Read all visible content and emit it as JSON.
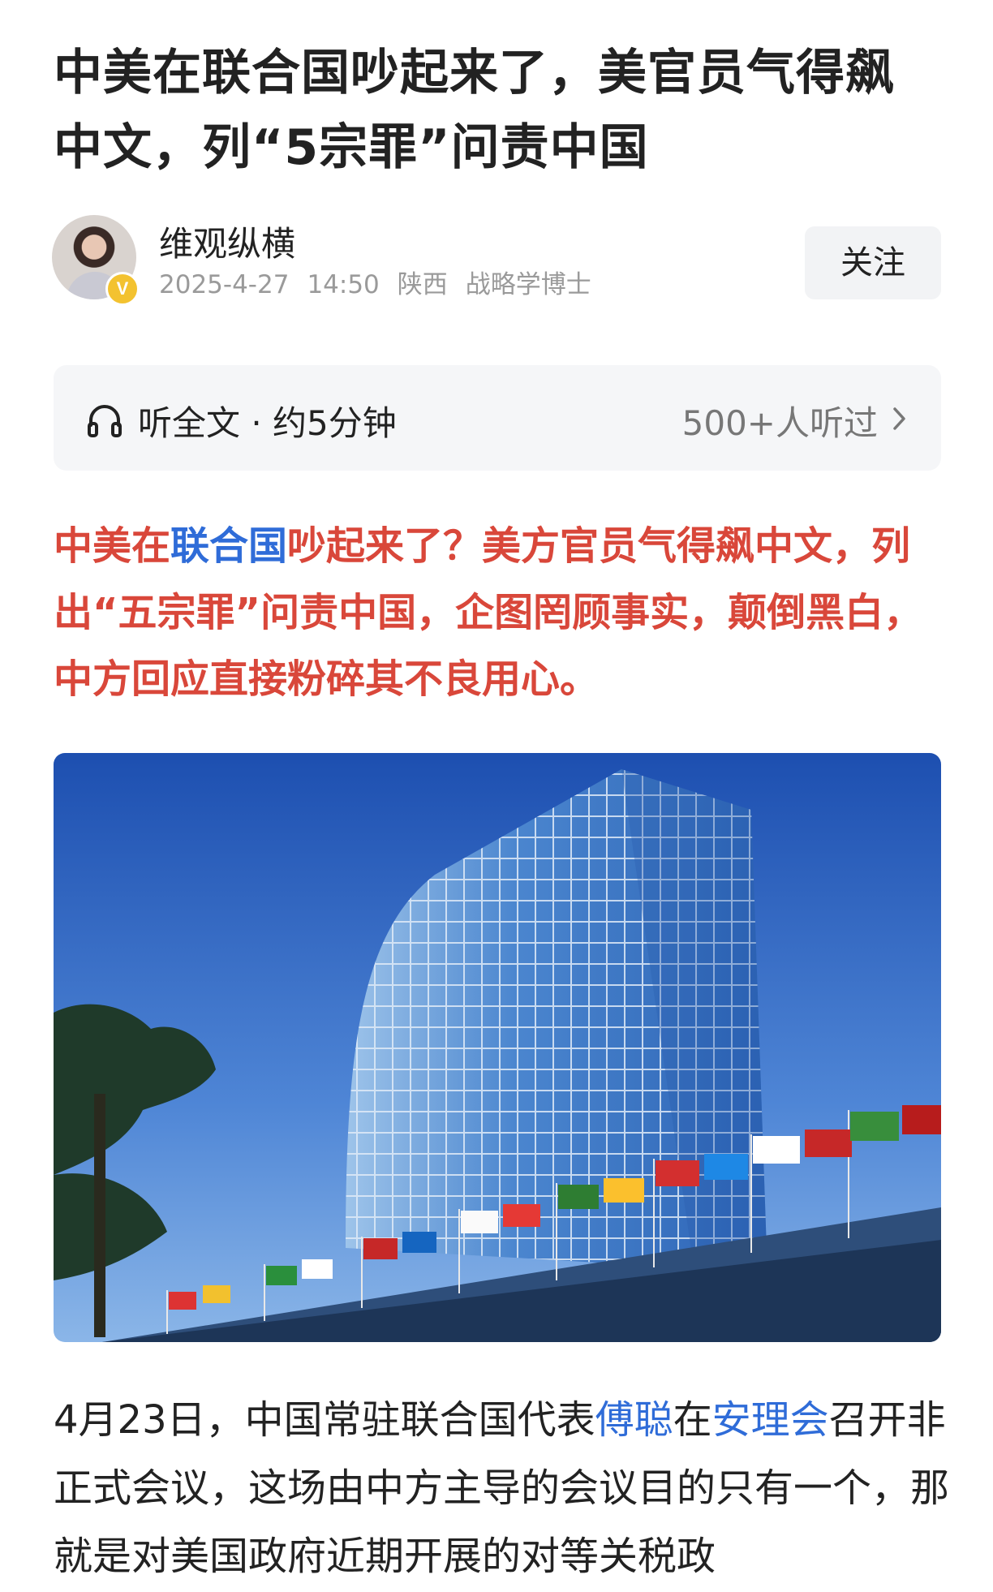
{
  "article": {
    "title_line1": "中美在联合国吵起来了，美官员气得飙",
    "title_line2": "中文，列“5宗罪”问责中国"
  },
  "author": {
    "name": "维观纵横",
    "verified_badge": "V",
    "date": "2025-4-27",
    "time": "14:50",
    "location": "陕西",
    "tag": "战略学博士",
    "follow_label": "关注"
  },
  "listen": {
    "icon": "headphone-icon",
    "label": "听全文 · 约5分钟",
    "count": "500+人听过"
  },
  "lead": {
    "part1": "中美在",
    "link1": "联合国",
    "part2": "吵起来了？美方官员气得飙中文，列出“五宗罪”问责中国，企图罔顾事实，颠倒黑白，中方回应直接粉碎其不良用心。"
  },
  "body": {
    "part1": "4月23日，中国常驻联合国代表",
    "link1": "傅聪",
    "part2": "在",
    "link2": "安理会",
    "part3": "召开非正式会议，这场由中方主导的会议目的只有一个，那就是对美国政府近期开展的对等关税政"
  },
  "colors": {
    "lead_red": "#d9473a",
    "link_blue": "#2f6cd8",
    "meta_gray": "#9a9a9a"
  }
}
